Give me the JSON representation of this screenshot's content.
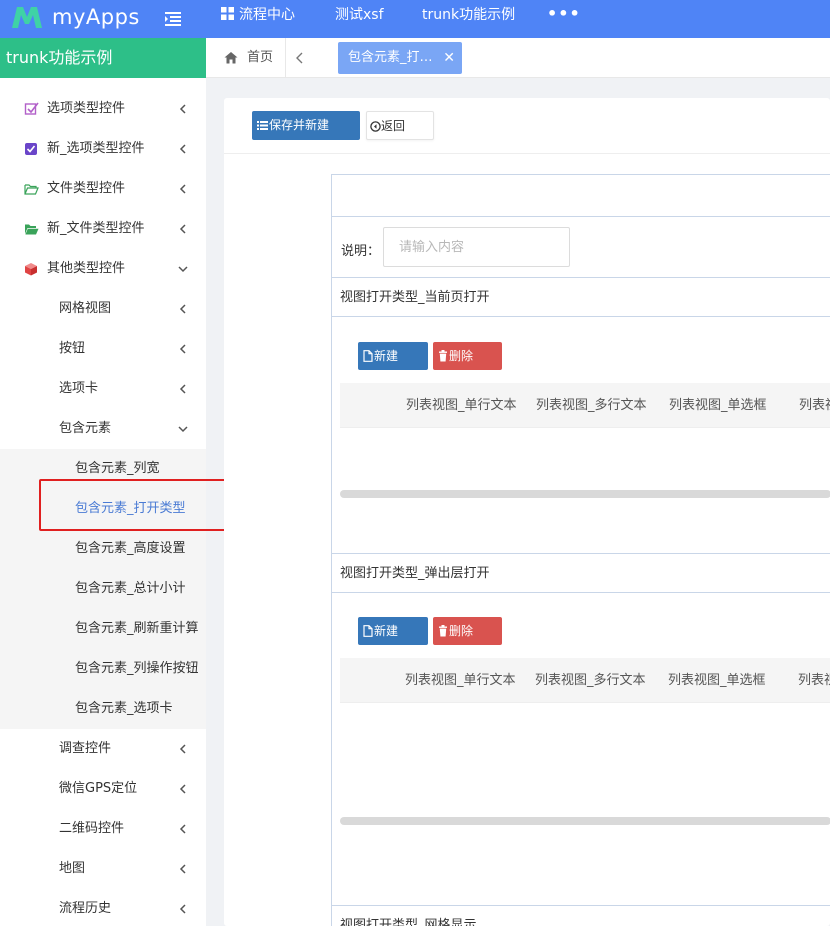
{
  "app": {
    "logo_text": "myApps",
    "brand_color": "#4f84f6",
    "logo_icon": "m-logo-icon"
  },
  "topnav": {
    "items": [
      {
        "label": "流程中心",
        "icon": "grid-icon"
      },
      {
        "label": "测试xsf"
      },
      {
        "label": "trunk功能示例"
      }
    ],
    "more_label": "•••"
  },
  "sidebar": {
    "title": "trunk功能示例",
    "title_color": "#2dbf88",
    "items": [
      {
        "label": "选项类型控件",
        "icon": "checkbox-outline-icon"
      },
      {
        "label": "新_选项类型控件",
        "icon": "checkbox-checked-icon"
      },
      {
        "label": "文件类型控件",
        "icon": "folder-open-outline-icon"
      },
      {
        "label": "新_文件类型控件",
        "icon": "folder-open-filled-icon"
      },
      {
        "label": "其他类型控件",
        "icon": "cube-icon"
      },
      {
        "label": "网格视图"
      },
      {
        "label": "按钮"
      },
      {
        "label": "选项卡"
      },
      {
        "label": "包含元素"
      },
      {
        "label": "包含元素_列宽"
      },
      {
        "label": "包含元素_打开类型"
      },
      {
        "label": "包含元素_高度设置"
      },
      {
        "label": "包含元素_总计小计"
      },
      {
        "label": "包含元素_刷新重计算"
      },
      {
        "label": "包含元素_列操作按钮"
      },
      {
        "label": "包含元素_选项卡"
      },
      {
        "label": "调查控件"
      },
      {
        "label": "微信GPS定位"
      },
      {
        "label": "二维码控件"
      },
      {
        "label": "地图"
      },
      {
        "label": "流程历史"
      }
    ]
  },
  "tabs": {
    "home_label": "首页",
    "active_label": "包含元素_打开类型",
    "close_glyph": "✕"
  },
  "toolbar": {
    "save_new_label": "保存并新建",
    "back_label": "返回"
  },
  "form": {
    "desc_label": "说明：",
    "desc_placeholder": "请输入内容",
    "sections": [
      {
        "title": "视图打开类型_当前页打开",
        "new_label": "新建",
        "delete_label": "删除",
        "columns": [
          "列表视图_单行文本",
          "列表视图_多行文本",
          "列表视图_单选框",
          "列表视"
        ]
      },
      {
        "title": "视图打开类型_弹出层打开",
        "new_label": "新建",
        "delete_label": "删除",
        "columns": [
          "列表视图_单行文本",
          "列表视图_多行文本",
          "列表视图_单选框",
          "列表视"
        ]
      },
      {
        "title": "视图打开类型_网格显示"
      }
    ]
  },
  "colors": {
    "primary_button": "#3677b9",
    "danger_button": "#d9534f",
    "active_tab": "#7aa6f5",
    "active_menu_text": "#4a7bd4",
    "highlight_box": "#e02020"
  }
}
